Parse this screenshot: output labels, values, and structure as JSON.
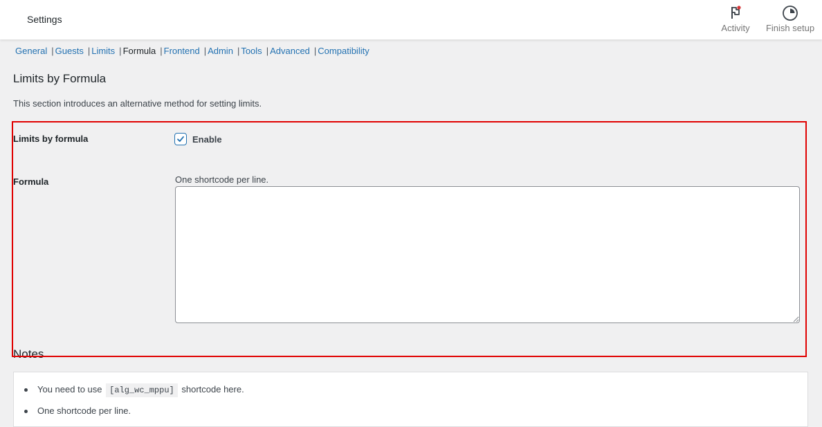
{
  "header": {
    "title": "Settings",
    "activity_label": "Activity",
    "finish_setup_label": "Finish setup"
  },
  "tabs": [
    {
      "label": "General",
      "current": false
    },
    {
      "label": "Guests",
      "current": false
    },
    {
      "label": "Limits",
      "current": false
    },
    {
      "label": "Formula",
      "current": true
    },
    {
      "label": "Frontend",
      "current": false
    },
    {
      "label": "Admin",
      "current": false
    },
    {
      "label": "Tools",
      "current": false
    },
    {
      "label": "Advanced",
      "current": false
    },
    {
      "label": "Compatibility",
      "current": false
    }
  ],
  "section": {
    "title": "Limits by Formula",
    "description": "This section introduces an alternative method for setting limits."
  },
  "fields": {
    "limits_by_formula": {
      "label": "Limits by formula",
      "checkbox_label": "Enable",
      "checked": true
    },
    "formula": {
      "label": "Formula",
      "description": "One shortcode per line.",
      "value": ""
    }
  },
  "notes": {
    "title": "Notes",
    "items": [
      {
        "before": "You need to use",
        "code": "[alg_wc_mppu]",
        "after": "shortcode here."
      },
      {
        "before": "One shortcode per line.",
        "code": "",
        "after": ""
      }
    ]
  },
  "colors": {
    "link": "#2271b1",
    "highlight_border": "#e00000",
    "activity_badge": "#d63638"
  },
  "icons": {
    "activity": "flag-icon",
    "finish_setup": "progress-circle-icon",
    "checkbox": "checkmark-icon"
  }
}
